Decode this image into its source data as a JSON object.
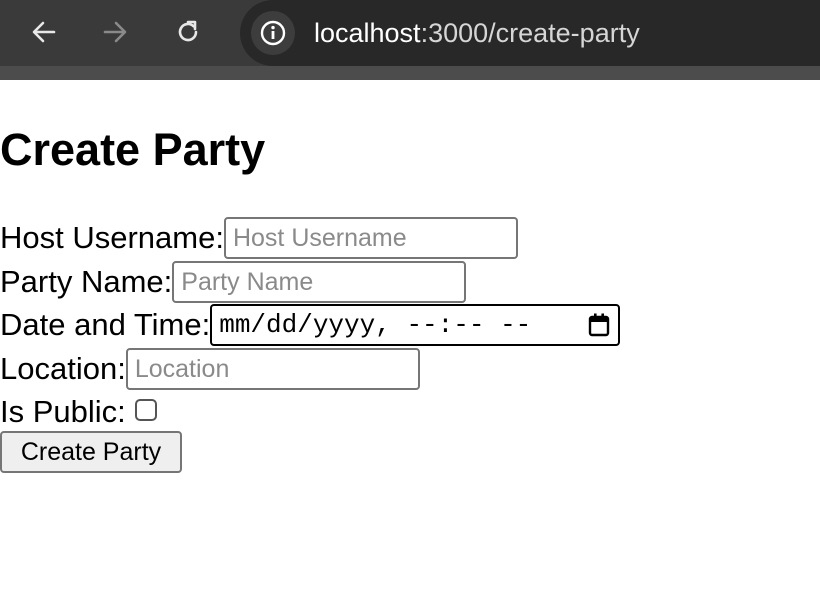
{
  "browser": {
    "url_host": "localhost",
    "url_path": ":3000/create-party",
    "icons": {
      "back": "back-arrow-icon",
      "forward": "forward-arrow-icon",
      "reload": "reload-icon",
      "site_info": "info-icon"
    }
  },
  "page": {
    "title": "Create Party",
    "fields": {
      "host_username": {
        "label": "Host Username:",
        "placeholder": "Host Username",
        "value": ""
      },
      "party_name": {
        "label": "Party Name:",
        "placeholder": "Party Name",
        "value": ""
      },
      "date_time": {
        "label": "Date and Time:",
        "display": "mm/dd/yyyy, --:-- --"
      },
      "location": {
        "label": "Location:",
        "placeholder": "Location",
        "value": ""
      },
      "is_public": {
        "label": "Is Public:",
        "checked": false
      }
    },
    "submit_label": "Create Party"
  }
}
